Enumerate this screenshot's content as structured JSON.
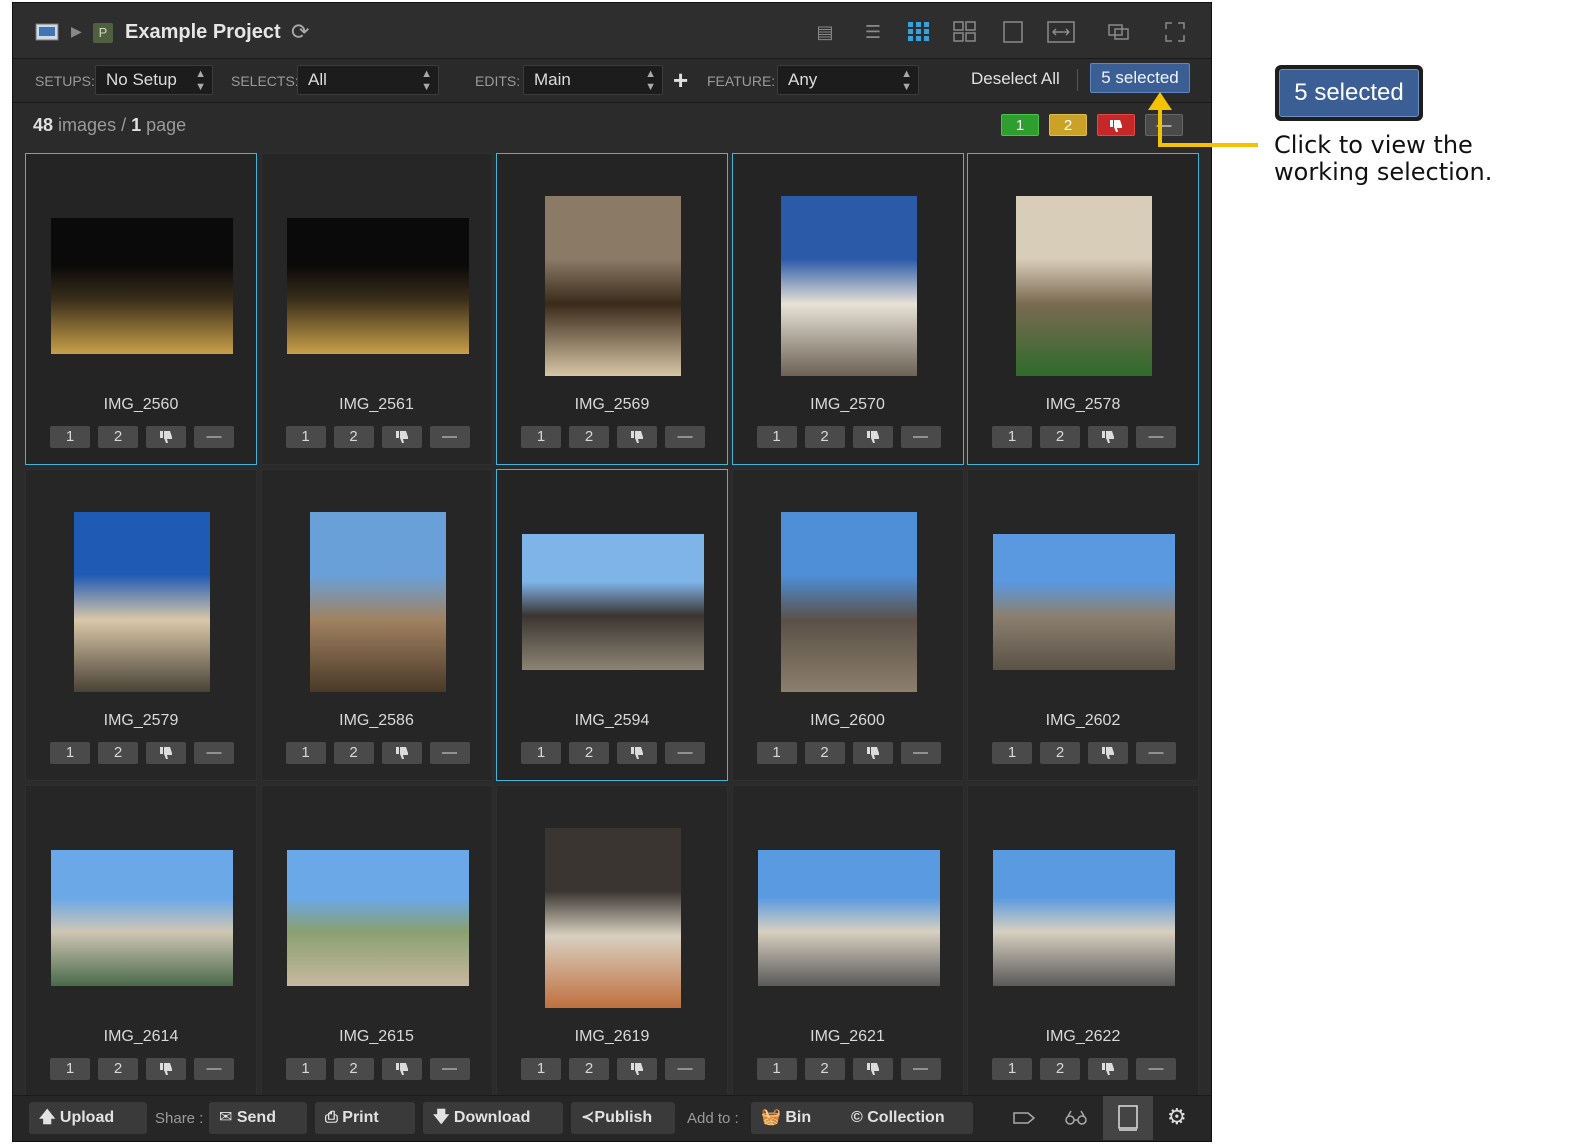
{
  "titlebar": {
    "project_title": "Example Project",
    "project_badge": "P"
  },
  "filters": {
    "setups_label": "SETUPS:",
    "setups_value": "No Setup",
    "selects_label": "SELECTS:",
    "selects_value": "All",
    "edits_label": "EDITS:",
    "edits_value": "Main",
    "feature_label": "FEATURE:",
    "feature_value": "Any",
    "deselect_all": "Deselect All",
    "selected_count": "5 selected"
  },
  "info": {
    "images_count": "48",
    "images_word": "images /",
    "pages_count": "1",
    "pages_word": "page"
  },
  "color_filters": {
    "one": "1",
    "two": "2"
  },
  "rating_labels": {
    "one": "1",
    "two": "2",
    "minus": "—"
  },
  "images": [
    {
      "name": "IMG_2560",
      "selected": true
    },
    {
      "name": "IMG_2561",
      "selected": false
    },
    {
      "name": "IMG_2569",
      "selected": true
    },
    {
      "name": "IMG_2570",
      "selected": true
    },
    {
      "name": "IMG_2578",
      "selected": true
    },
    {
      "name": "IMG_2579",
      "selected": false
    },
    {
      "name": "IMG_2586",
      "selected": false
    },
    {
      "name": "IMG_2594",
      "selected": true
    },
    {
      "name": "IMG_2600",
      "selected": false
    },
    {
      "name": "IMG_2602",
      "selected": false
    },
    {
      "name": "IMG_2614",
      "selected": false
    },
    {
      "name": "IMG_2615",
      "selected": false
    },
    {
      "name": "IMG_2619",
      "selected": false
    },
    {
      "name": "IMG_2621",
      "selected": false
    },
    {
      "name": "IMG_2622",
      "selected": false
    }
  ],
  "bottombar": {
    "upload": "Upload",
    "share_label": "Share :",
    "send": "Send",
    "print": "Print",
    "download": "Download",
    "publish": "Publish",
    "addto_label": "Add to :",
    "bin": "Bin",
    "collection": "Collection"
  },
  "annotation": {
    "button": "5 selected",
    "line1": "Click to view the",
    "line2": "working selection."
  },
  "colors": {
    "accent": "#45b4d9",
    "selected_btn": "#3b5f95",
    "arrow": "#f5c200",
    "green": "#2e9e2e",
    "yellow": "#c9a227",
    "red": "#c62828"
  }
}
